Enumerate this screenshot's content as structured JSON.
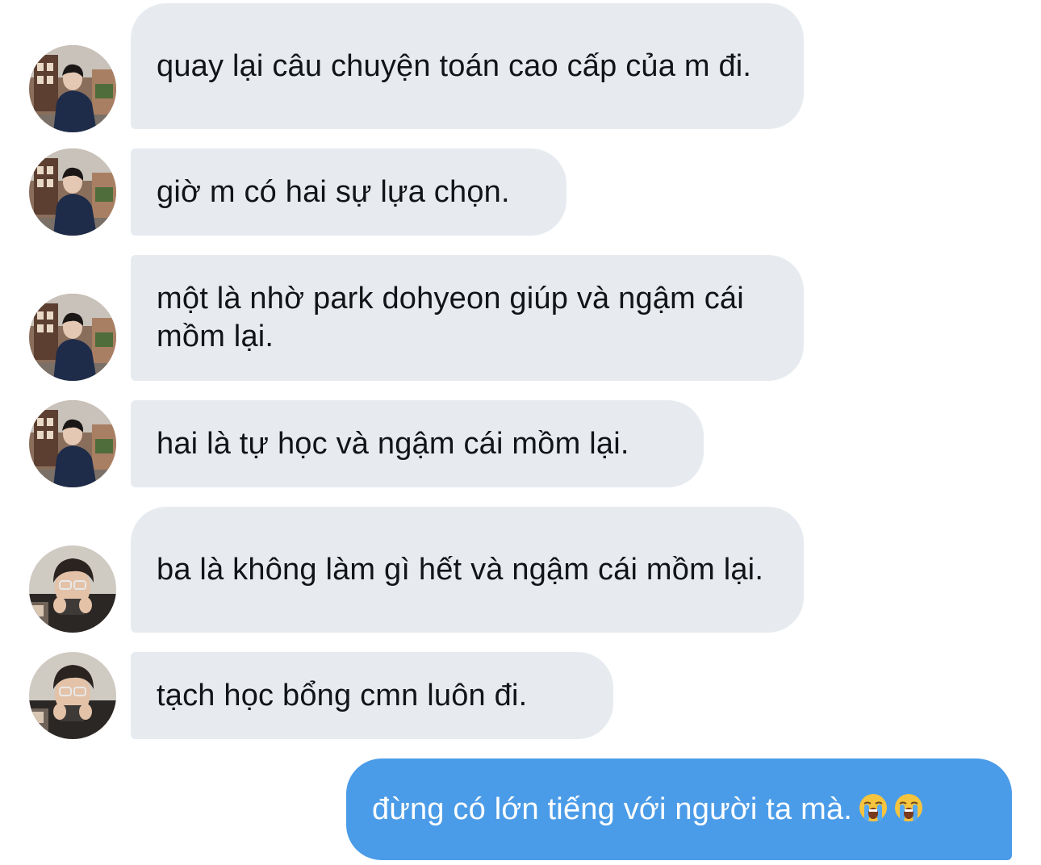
{
  "conversation": {
    "messages": [
      {
        "sender": "friend-a",
        "text": "quay lại câu chuyện toán cao cấp của m đi."
      },
      {
        "sender": "friend-a",
        "text": "giờ m có hai sự lựa chọn."
      },
      {
        "sender": "friend-a",
        "text": "một là nhờ park dohyeon giúp và ngậm cái mồm lại."
      },
      {
        "sender": "friend-a",
        "text": "hai là tự học và ngậm cái mồm lại."
      },
      {
        "sender": "friend-b",
        "text": "ba là không làm gì hết và ngậm cái mồm lại."
      },
      {
        "sender": "friend-b",
        "text": "tạch học bổng cmn luôn đi."
      },
      {
        "sender": "me",
        "text": "đừng có lớn tiếng với người ta mà.",
        "emoji": [
          "loudly-crying-face-icon",
          "loudly-crying-face-icon"
        ]
      }
    ]
  },
  "colors": {
    "incoming_bubble": "#e7ebf0",
    "incoming_text": "#121417",
    "outgoing_bubble": "#4b9ce8",
    "outgoing_text": "#ffffff"
  }
}
